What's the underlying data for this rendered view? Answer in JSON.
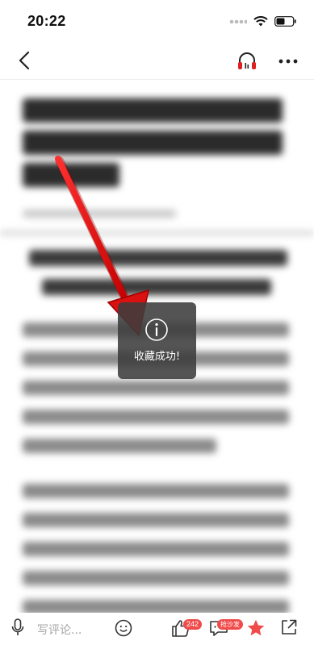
{
  "status_bar": {
    "time": "20:22"
  },
  "toast": {
    "message": "收藏成功!",
    "icon": "info-icon"
  },
  "bottom_bar": {
    "comment_placeholder": "写评论...",
    "like_count": "242",
    "comment_badge": "抢沙发"
  },
  "icons": {
    "back": "chevron-left-icon",
    "headphone": "headphone-icon",
    "more": "more-dots-icon",
    "mic": "microphone-icon",
    "emoji": "emoji-icon",
    "like": "thumbs-up-icon",
    "comment": "comment-icon",
    "favorite": "star-icon",
    "share": "share-icon"
  },
  "colors": {
    "accent_red": "#e02020",
    "favorite_star": "#f04a4a",
    "toast_bg": "#3c3c3c",
    "badge_red": "#f04a4a"
  }
}
